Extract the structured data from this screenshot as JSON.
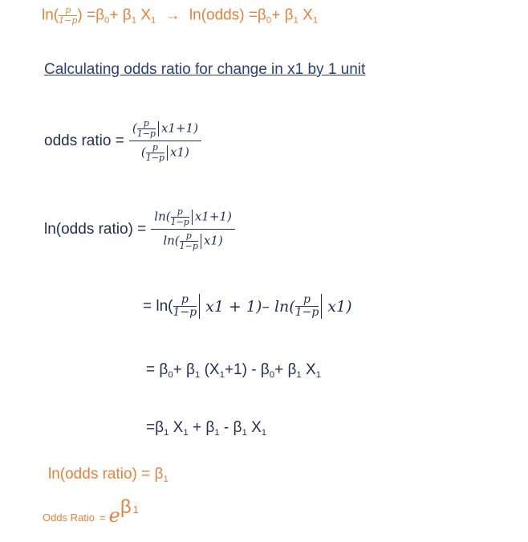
{
  "formula_top": {
    "ln": "ln(",
    "p": "p",
    "one_minus_p": "1−p",
    "close": ")",
    "eq1": "=β",
    "zero": "0",
    "plus_beta": "+ β",
    "one": "1",
    "X": "X",
    "arrow": "→",
    "ln_odds": "ln(odds) =β",
    "sub1": "1"
  },
  "heading": "Calculating odds ratio for change in x1 by 1 unit",
  "odds_ratio_def": {
    "label": "odds ratio =",
    "num_tail": "x1+1)",
    "den_tail": "x1)",
    "p": "p",
    "one_minus_p": "1−p"
  },
  "ln_odds_def": {
    "label": "ln(odds ratio) =",
    "ln": "ln(",
    "num_tail": "x1+1)",
    "den_tail": "x1)",
    "p": "p",
    "one_minus_p": "1−p"
  },
  "step1": {
    "eq": "= ln(",
    "tail1": "x1 + 1)– ln(",
    "tail2": "x1)",
    "p": "p",
    "one_minus_p": "1−p"
  },
  "step2": {
    "a": "= β",
    "b": "+ β",
    "c": "(X",
    "d": "+1) - β",
    "e": "+ β",
    "f": "X",
    "zero": "0",
    "one": "1"
  },
  "step3": {
    "a": "=β",
    "b": "X",
    "c": "+ β",
    "d": "- β",
    "e": "X",
    "one": "1"
  },
  "result": {
    "text": "ln(odds ratio) = β",
    "one": "1"
  },
  "final": {
    "label": "Odds Ratio",
    "eq": "=",
    "e": "e",
    "beta": "β",
    "one": "1"
  }
}
